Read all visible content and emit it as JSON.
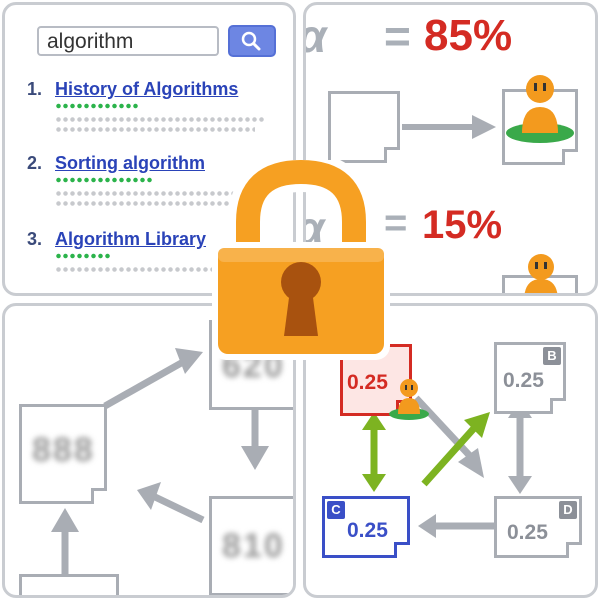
{
  "search": {
    "query": "algorithm",
    "button_icon": "magnifier-icon"
  },
  "results": [
    {
      "num": "1.",
      "title": "History of Algorithms"
    },
    {
      "num": "2.",
      "title": "Sorting algorithm"
    },
    {
      "num": "3.",
      "title": "Algorithm Library"
    }
  ],
  "equations": {
    "alpha": "α",
    "equals": "=",
    "first_pct": "85%",
    "second_pct": "15%"
  },
  "graph_doc_texts": [
    "888",
    "620",
    "810"
  ],
  "pagerank": {
    "nodes": [
      {
        "id": "A",
        "label": "",
        "score": "0.25",
        "color": "#d42b23"
      },
      {
        "id": "B",
        "label": "B",
        "score": "0.25",
        "color": "#8c9098"
      },
      {
        "id": "C",
        "label": "C",
        "score": "0.25",
        "color": "#3a4fc7"
      },
      {
        "id": "D",
        "label": "D",
        "score": "0.25",
        "color": "#8c9098"
      }
    ]
  },
  "colors": {
    "accent_red": "#d42b23",
    "accent_blue": "#3a4fc7",
    "accent_green": "#7db321",
    "lock_orange": "#f6a022",
    "person_orange": "#f39a1e"
  }
}
